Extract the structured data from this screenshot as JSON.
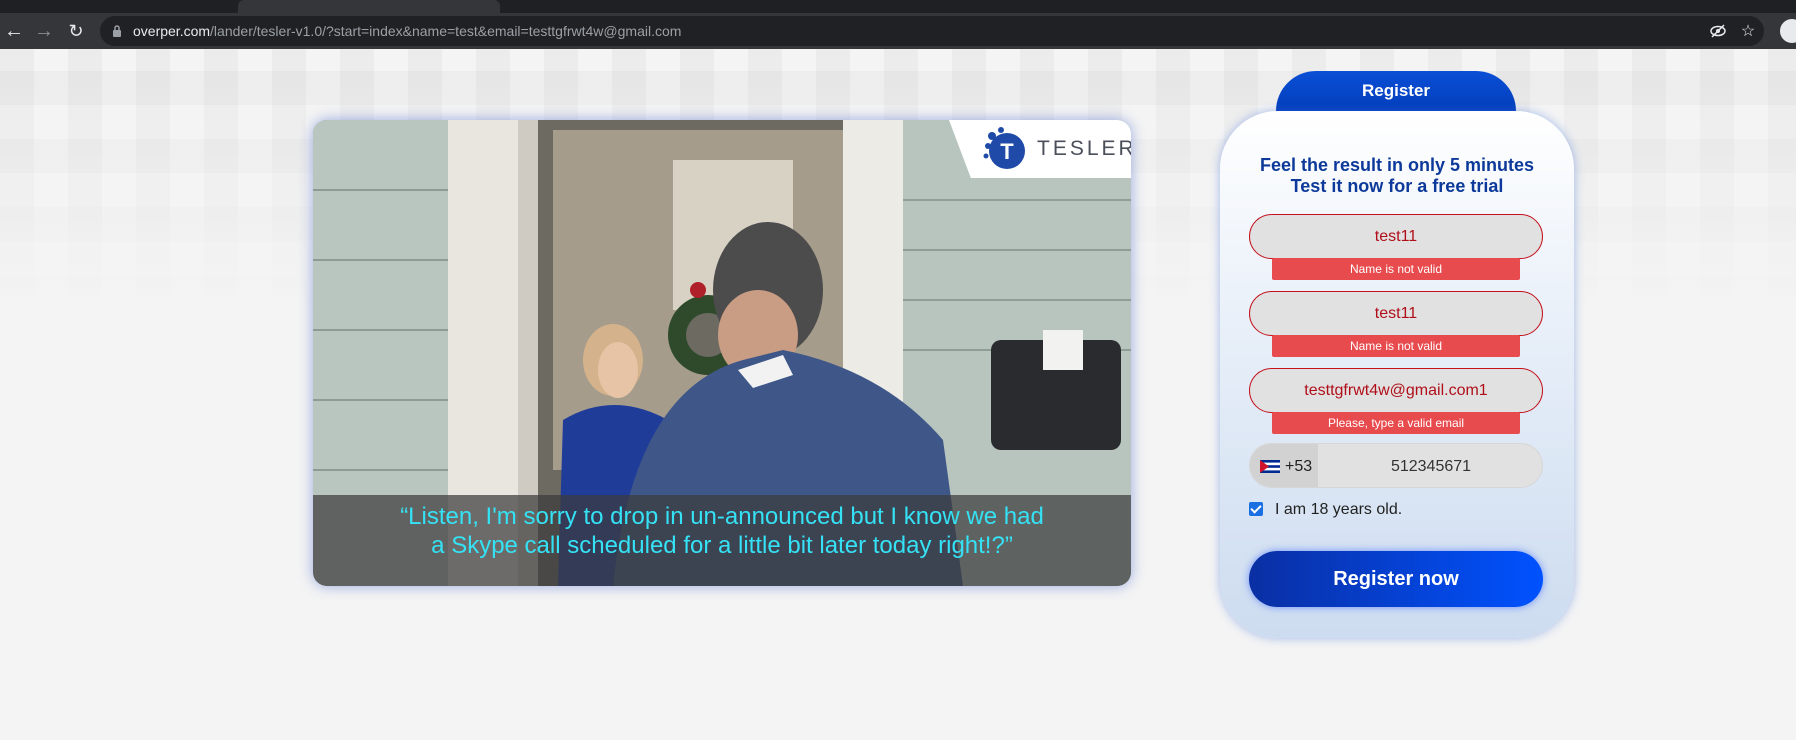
{
  "browser": {
    "url_host": "overper.com",
    "url_path": "/lander/tesler-v1.0/?start=index&name=test&email=testtgfrwt4w@gmail.com"
  },
  "video": {
    "logo_text": "TESLER",
    "logo_letter": "T",
    "caption_line1": "“Listen, I'm sorry to drop in un-announced but I know we had",
    "caption_line2": "a Skype call scheduled for a little bit later today right!?”"
  },
  "form": {
    "tab_label": "Register",
    "headline_line1": "Feel the result in only 5 minutes",
    "headline_line2": "Test it now for a free trial",
    "first_name": "test11",
    "first_name_error": "Name is not valid",
    "last_name": "test11",
    "last_name_error": "Name is not valid",
    "email": "testtgfrwt4w@gmail.com1",
    "email_error": "Please, type a valid email",
    "phone_code": "+53",
    "phone_number": "512345671",
    "age_label": "I am 18 years old.",
    "age_checked": true,
    "submit_label": "Register now"
  },
  "colors": {
    "brand_blue": "#0d3a9a",
    "button_blue": "#0052ff",
    "error_red": "#e84b4e",
    "caption_cyan": "#35e2f5"
  }
}
